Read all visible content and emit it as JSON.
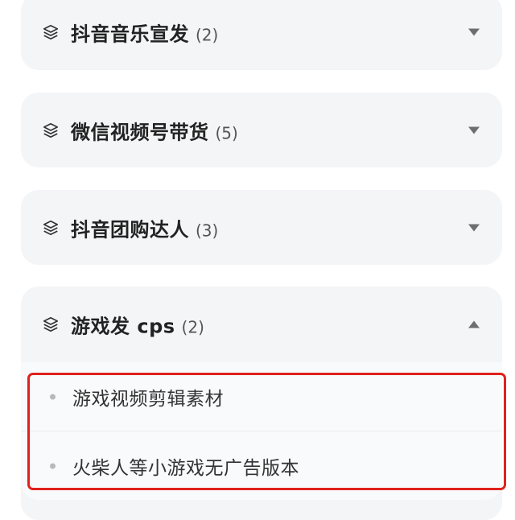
{
  "categories": [
    {
      "title": "抖音音乐宣发",
      "count": "(2)",
      "expanded": false,
      "icon": "layers-icon"
    },
    {
      "title": "微信视频号带货",
      "count": "(5)",
      "expanded": false,
      "icon": "layers-icon"
    },
    {
      "title": "抖音团购达人",
      "count": "(3)",
      "expanded": false,
      "icon": "layers-icon"
    },
    {
      "title": "游戏发 cps",
      "count": "(2)",
      "expanded": true,
      "icon": "layers-icon",
      "items": [
        {
          "label": "游戏视频剪辑素材"
        },
        {
          "label": "火柴人等小游戏无广告版本"
        }
      ]
    }
  ],
  "colors": {
    "panel_bg": "#f4f5f7",
    "highlight": "#e0211d",
    "chevron": "#6e6e6e"
  }
}
